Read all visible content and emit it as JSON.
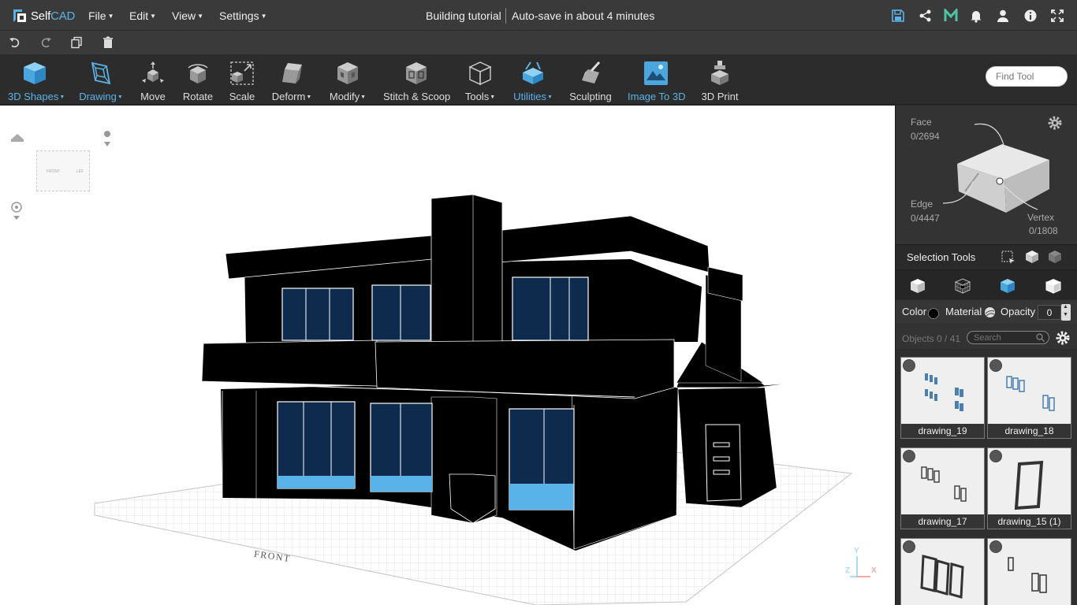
{
  "app": {
    "logo_self": "Self",
    "logo_cad": "CAD"
  },
  "menu": {
    "file": "File",
    "edit": "Edit",
    "view": "View",
    "settings": "Settings"
  },
  "document": {
    "title": "Building tutorial",
    "autosave": "Auto-save in about 4 minutes"
  },
  "toolbar": {
    "shapes": "3D Shapes",
    "drawing": "Drawing",
    "move": "Move",
    "rotate": "Rotate",
    "scale": "Scale",
    "deform": "Deform",
    "modify": "Modify",
    "stitch": "Stitch & Scoop",
    "tools": "Tools",
    "utilities": "Utilities",
    "sculpting": "Sculpting",
    "image3d": "Image To 3D",
    "print3d": "3D Print",
    "find_placeholder": "Find Tool"
  },
  "viewport": {
    "viewcube_front": "FRONT",
    "viewcube_left": "LEF",
    "grid_label": "FRONT",
    "axis_y": "Y",
    "axis_z": "Z",
    "axis_x": "X"
  },
  "selection": {
    "face_label": "Face",
    "face_count": "0/2694",
    "edge_label": "Edge",
    "edge_count": "0/4447",
    "vertex_label": "Vertex",
    "vertex_count": "0/1808",
    "tools_label": "Selection Tools"
  },
  "properties": {
    "color_label": "Color",
    "color_value": "#000000",
    "material_label": "Material",
    "opacity_label": "Opacity",
    "opacity_value": "0"
  },
  "objects": {
    "count_label": "Objects 0 / 41",
    "search_placeholder": "Search",
    "items": [
      {
        "name": "drawing_19"
      },
      {
        "name": "drawing_18"
      },
      {
        "name": "drawing_17"
      },
      {
        "name": "drawing_15 (1)"
      }
    ]
  },
  "colors": {
    "accent": "#5ab3e8",
    "glass": "#0e2a4d",
    "bg_dark": "#2c2c2c"
  }
}
